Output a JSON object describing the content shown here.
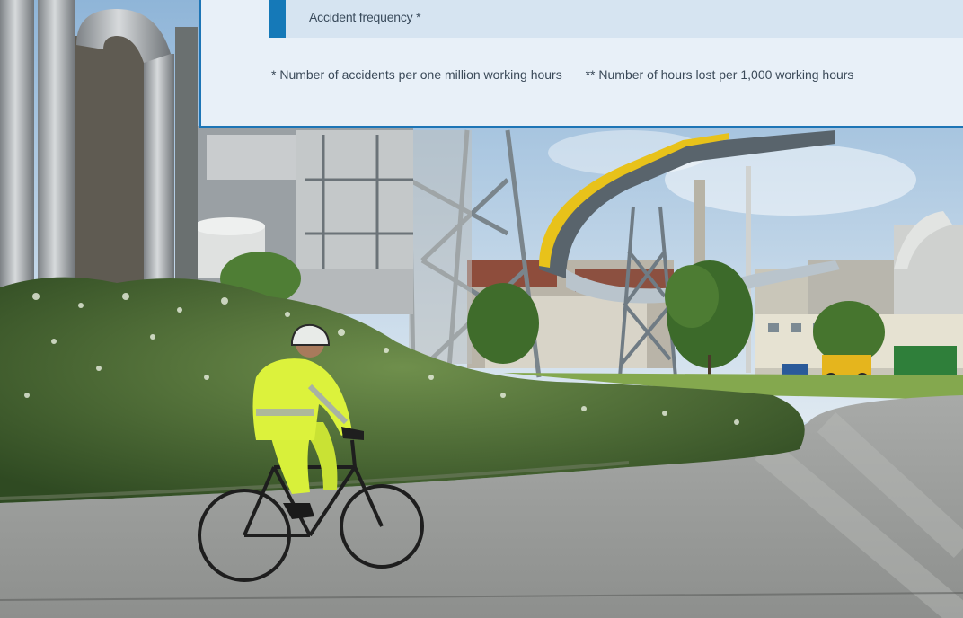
{
  "panel": {
    "legend_label": "Accident frequency *",
    "footnote_1": "* Number of accidents per one million working hours",
    "footnote_2": "** Number of hours lost per 1,000 working hours"
  },
  "colors": {
    "accent_blue": "#1579b8",
    "panel_bg": "#e8f0f8",
    "legend_bg": "#d6e4f1",
    "conveyor_yellow": "#e8c21a",
    "vest_yellow": "#d8f03a"
  },
  "photo": {
    "subject": "cyclist-in-hi-vis-at-industrial-site"
  }
}
